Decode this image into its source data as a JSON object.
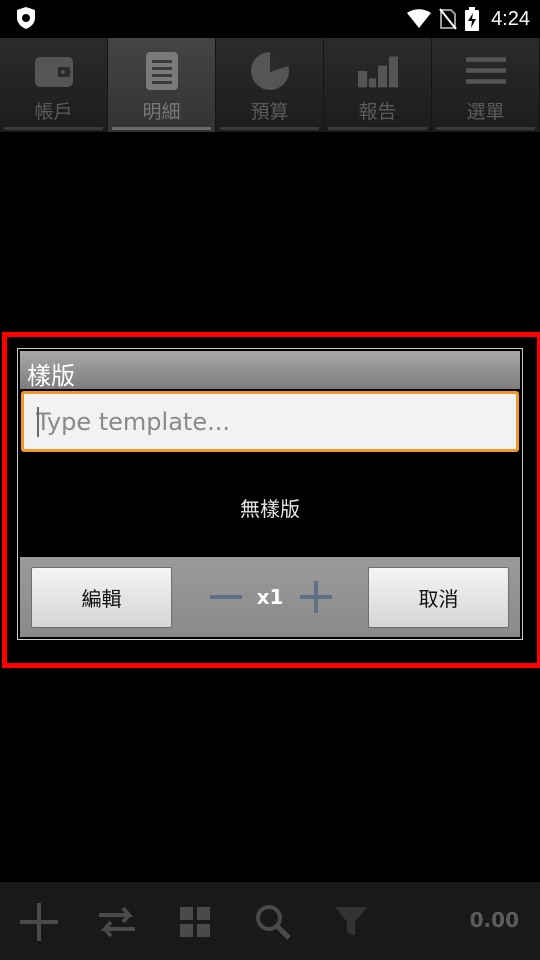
{
  "status_bar": {
    "time": "4:24"
  },
  "tabs": [
    {
      "label": "帳戶",
      "icon": "wallet-icon",
      "active": false
    },
    {
      "label": "明細",
      "icon": "document-icon",
      "active": true
    },
    {
      "label": "預算",
      "icon": "pie-chart-icon",
      "active": false
    },
    {
      "label": "報告",
      "icon": "bar-chart-icon",
      "active": false
    },
    {
      "label": "選單",
      "icon": "menu-icon",
      "active": false
    }
  ],
  "dialog": {
    "title": "樣版",
    "input_placeholder": "Type template...",
    "input_value": "",
    "empty_text": "無樣版",
    "edit_label": "編輯",
    "multiplier": "x1",
    "cancel_label": "取消"
  },
  "bottom_bar": {
    "total": "0.00"
  },
  "colors": {
    "highlight": "#ff0000",
    "input_border": "#f4962b",
    "background": "#000000"
  }
}
